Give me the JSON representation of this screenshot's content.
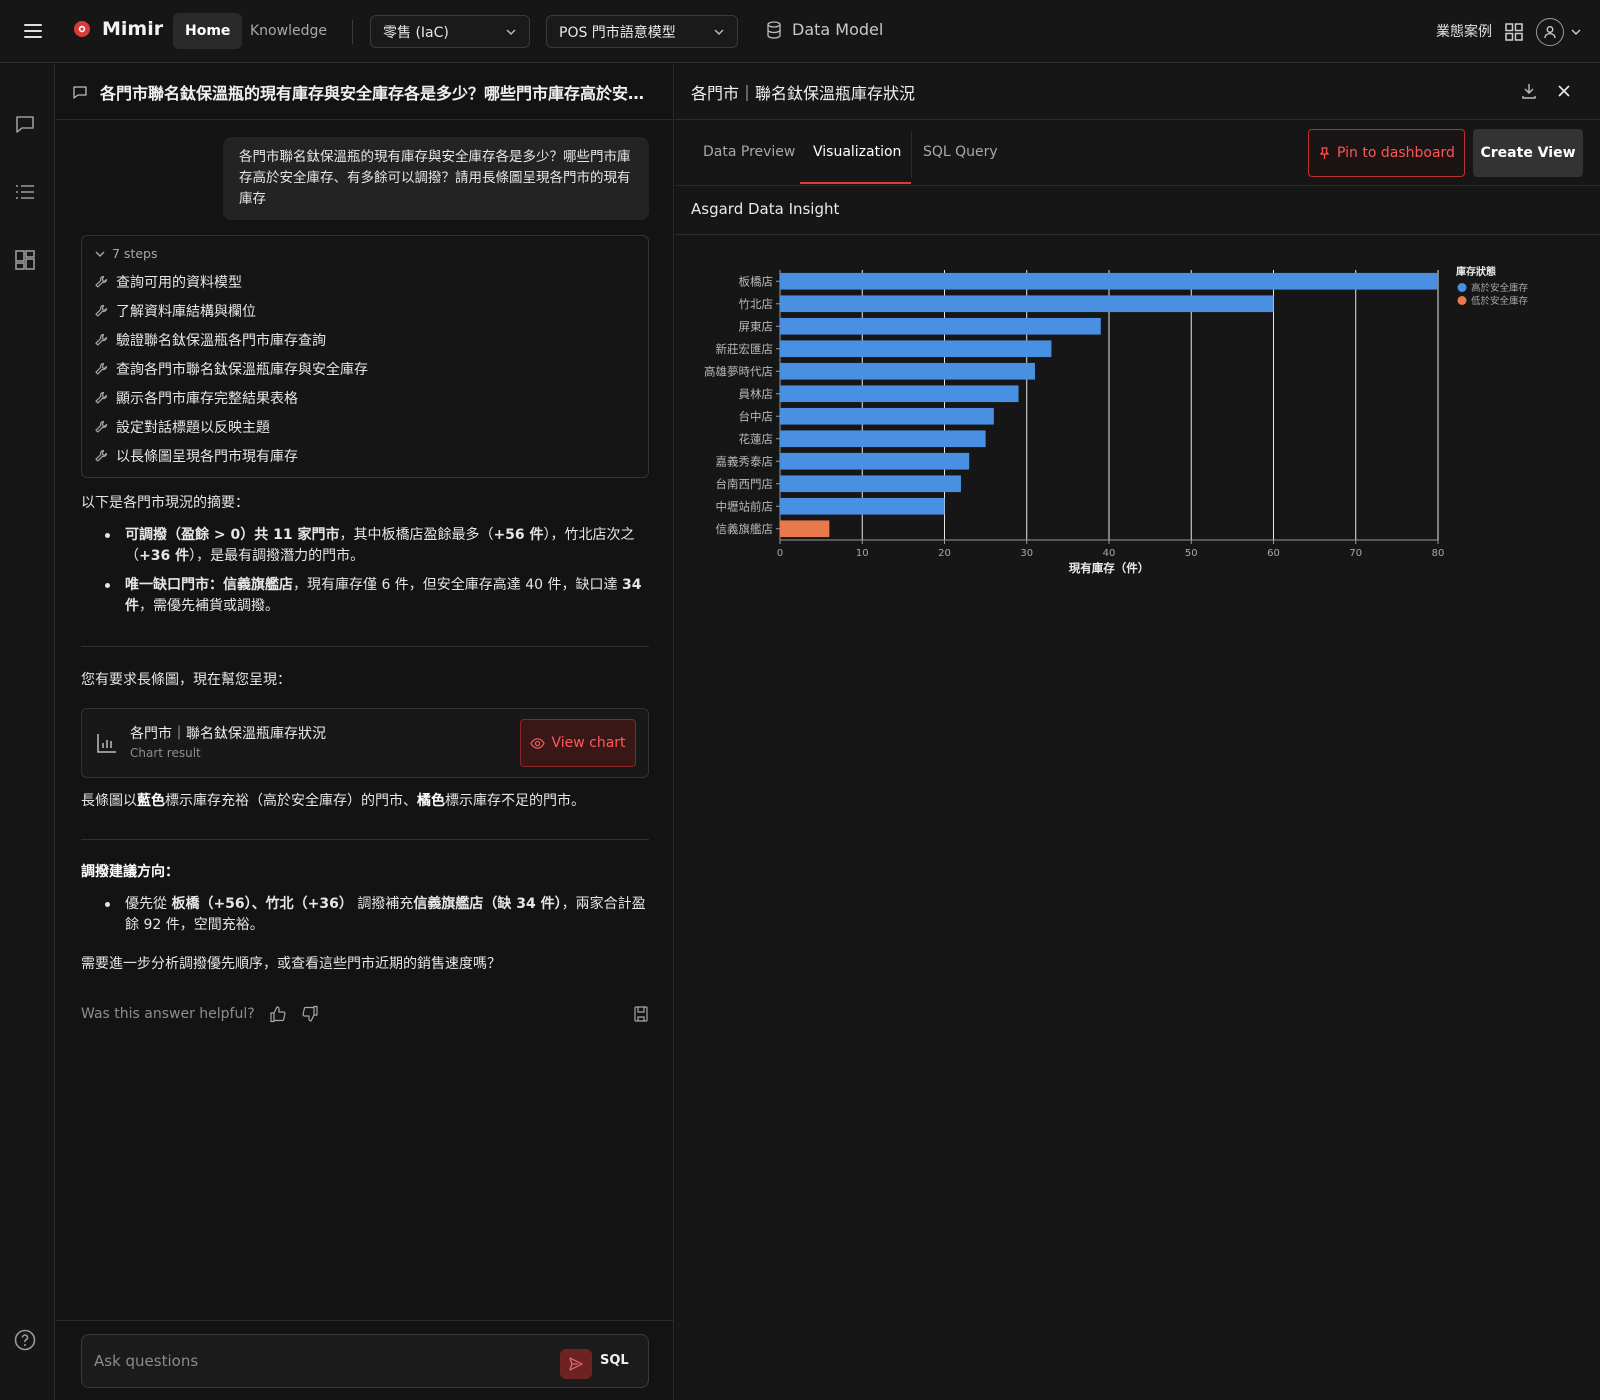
{
  "topbar": {
    "brand": "Mimir",
    "nav_home": "Home",
    "nav_knowledge": "Knowledge",
    "select_industry": "零售 (IaC)",
    "select_model": "POS 門市語意模型",
    "data_model": "Data Model",
    "biz_cases": "業態案例"
  },
  "chat": {
    "title": "各門市聯名鈦保溫瓶的現有庫存與安全庫存各是多少？哪些門市庫存高於安全...",
    "user_question": "各門市聯名鈦保溫瓶的現有庫存與安全庫存各是多少？哪些門市庫存高於安全庫存、有多餘可以調撥？請用長條圖呈現各門市的現有庫存",
    "steps_label": "7 steps",
    "steps": [
      "查詢可用的資料模型",
      "了解資料庫結構與欄位",
      "驗證聯名鈦保溫瓶各門市庫存查詢",
      "查詢各門市聯名鈦保溫瓶庫存與安全庫存",
      "顯示各門市庫存完整結果表格",
      "設定對話標題以反映主題",
      "以長條圖呈現各門市現有庫存"
    ],
    "summary_intro": "以下是各門市現況的摘要：",
    "b1_bold": "可調撥（盈餘 > 0）共 11 家門市",
    "b1_mid": "，其中板橋店盈餘最多（",
    "b1_bold2": "+56 件",
    "b1_mid2": "），竹北店次之（",
    "b1_bold3": "+36 件",
    "b1_end": "），是最有調撥潛力的門市。",
    "b2_bold": "唯一缺口門市：信義旗艦店",
    "b2_mid": "，現有庫存僅 6 件，但安全庫存高達 40 件，缺口達 ",
    "b2_bold2": "34 件",
    "b2_end": "，需優先補貨或調撥。",
    "chart_intro": "您有要求長條圖，現在幫您呈現：",
    "card_title": "各門市｜聯名鈦保溫瓶庫存狀況",
    "card_sub": "Chart result",
    "view_chart": "View chart",
    "legend_pre": "長條圖以",
    "legend_blue": "藍色",
    "legend_mid": "標示庫存充裕（高於安全庫存）的門市、",
    "legend_orange": "橘色",
    "legend_end": "標示庫存不足的門市。",
    "advice_title": "調撥建議方向：",
    "a1_pre": "優先從 ",
    "a1_bold": "板橋（+56）、竹北（+36）",
    "a1_mid": " 調撥補充",
    "a1_bold2": "信義旗艦店（缺 34 件）",
    "a1_end": "，兩家合計盈餘 92 件，空間充裕。",
    "followup": "需要進一步分析調撥優先順序，或查看這些門市近期的銷售速度嗎？",
    "feedback": "Was this answer helpful?",
    "ask_placeholder": "Ask questions",
    "sql": "SQL"
  },
  "panel": {
    "title": "各門市｜聯名鈦保溫瓶庫存狀況",
    "tabs": [
      "Data Preview",
      "Visualization",
      "SQL Query"
    ],
    "pin": "Pin to dashboard",
    "create_view": "Create View",
    "insight_title": "Asgard Data Insight"
  },
  "chart_data": {
    "type": "bar",
    "orientation": "horizontal",
    "categories": [
      "板橋店",
      "竹北店",
      "屏東店",
      "新莊宏匯店",
      "高雄夢時代店",
      "員林店",
      "台中店",
      "花蓮店",
      "嘉義秀泰店",
      "台南西門店",
      "中壢站前店",
      "信義旗艦店"
    ],
    "values": [
      80,
      60,
      39,
      33,
      31,
      29,
      26,
      25,
      23,
      22,
      20,
      6
    ],
    "status": [
      "高於安全庫存",
      "高於安全庫存",
      "高於安全庫存",
      "高於安全庫存",
      "高於安全庫存",
      "高於安全庫存",
      "高於安全庫存",
      "高於安全庫存",
      "高於安全庫存",
      "高於安全庫存",
      "高於安全庫存",
      "低於安全庫存"
    ],
    "xlabel": "現有庫存（件）",
    "xlim": [
      0,
      80
    ],
    "xticks": [
      0,
      10,
      20,
      30,
      40,
      50,
      60,
      70,
      80
    ],
    "grid": true,
    "legend_title": "庫存狀態",
    "legend": [
      {
        "label": "高於安全庫存",
        "color": "#4a90e2"
      },
      {
        "label": "低於安全庫存",
        "color": "#e8794d"
      }
    ],
    "legend_placement": "top-right"
  },
  "colors": {
    "accent": "#e03a3a",
    "bar_high": "#4a90e2",
    "bar_low": "#e8794d"
  }
}
